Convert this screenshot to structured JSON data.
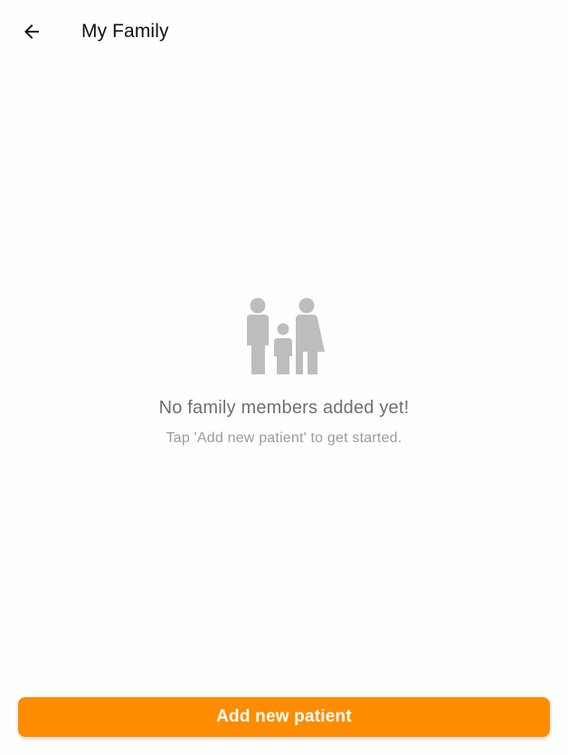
{
  "header": {
    "back_icon": "arrow-back-icon",
    "title": "My Family"
  },
  "empty_state": {
    "icon": "family-icon",
    "icon_color": "#bdbdbd",
    "title": "No family members added yet!",
    "subtitle": "Tap 'Add new patient' to get started."
  },
  "footer": {
    "add_button_label": "Add new patient",
    "accent_color": "#fe8c00"
  }
}
